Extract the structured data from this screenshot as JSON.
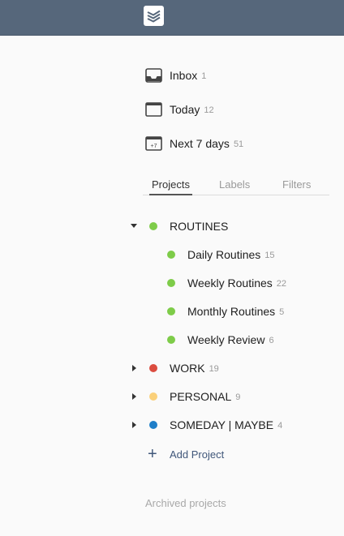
{
  "topbar": {
    "logo_icon": "todoist-logo-icon",
    "background": "#56677b"
  },
  "filters": [
    {
      "icon": "inbox-icon",
      "label": "Inbox",
      "count": "1"
    },
    {
      "icon": "calendar-today-icon",
      "label": "Today",
      "count": "12"
    },
    {
      "icon": "calendar-next7-icon",
      "label": "Next 7 days",
      "count": "51",
      "icon_text": "+7"
    }
  ],
  "tabs": [
    {
      "label": "Projects",
      "active": true
    },
    {
      "label": "Labels",
      "active": false
    },
    {
      "label": "Filters",
      "active": false
    }
  ],
  "projects": [
    {
      "name": "ROUTINES",
      "count": "",
      "color": "#7ecc49",
      "expanded": true,
      "level": 0
    },
    {
      "name": "Daily Routines",
      "count": "15",
      "color": "#7ecc49",
      "level": 1
    },
    {
      "name": "Weekly Routines",
      "count": "22",
      "color": "#7ecc49",
      "level": 1
    },
    {
      "name": "Monthly Routines",
      "count": "5",
      "color": "#7ecc49",
      "level": 1
    },
    {
      "name": "Weekly Review",
      "count": "6",
      "color": "#7ecc49",
      "level": 1
    },
    {
      "name": "WORK",
      "count": "19",
      "color": "#db4c3f",
      "expanded": false,
      "level": 0
    },
    {
      "name": "PERSONAL",
      "count": "9",
      "color": "#fad07a",
      "expanded": false,
      "level": 0
    },
    {
      "name": "SOMEDAY | MAYBE",
      "count": "4",
      "color": "#1e7ec8",
      "expanded": false,
      "level": 0
    }
  ],
  "add_project": {
    "label": "Add Project",
    "icon": "plus-icon"
  },
  "archived": {
    "label": "Archived projects"
  }
}
